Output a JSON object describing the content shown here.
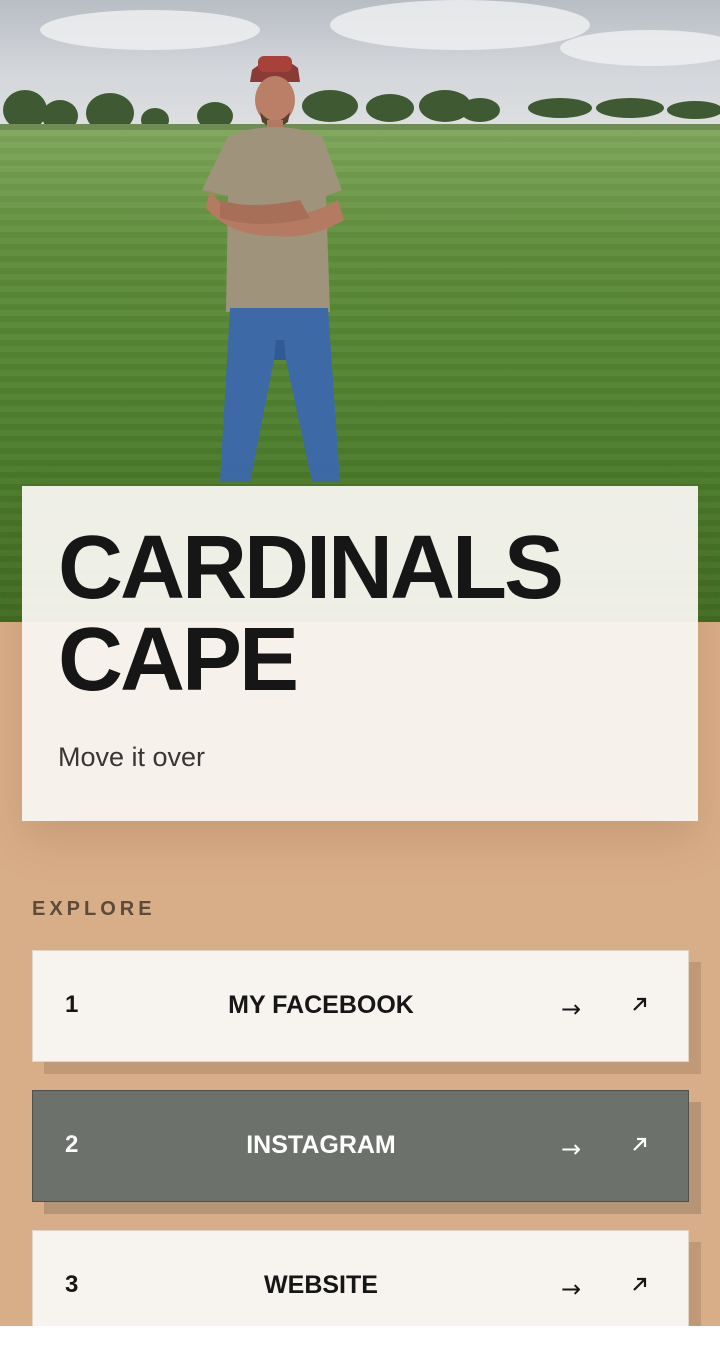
{
  "profile": {
    "title_line1": "CARDINALS",
    "title_line2": "CAPE",
    "tagline": "Move it over"
  },
  "explore": {
    "label": "EXPLORE",
    "links": [
      {
        "number": "1",
        "label": "MY FACEBOOK",
        "arrow": "→",
        "external_icon": "external-link-icon"
      },
      {
        "number": "2",
        "label": "INSTAGRAM",
        "arrow": "→",
        "external_icon": "external-link-icon"
      },
      {
        "number": "3",
        "label": "WEBSITE",
        "arrow": "→",
        "external_icon": "external-link-icon"
      }
    ]
  },
  "colors": {
    "background": "#d8ae88",
    "card": "#f7f3ee",
    "highlight_card": "#6d716b",
    "text": "#161616"
  }
}
